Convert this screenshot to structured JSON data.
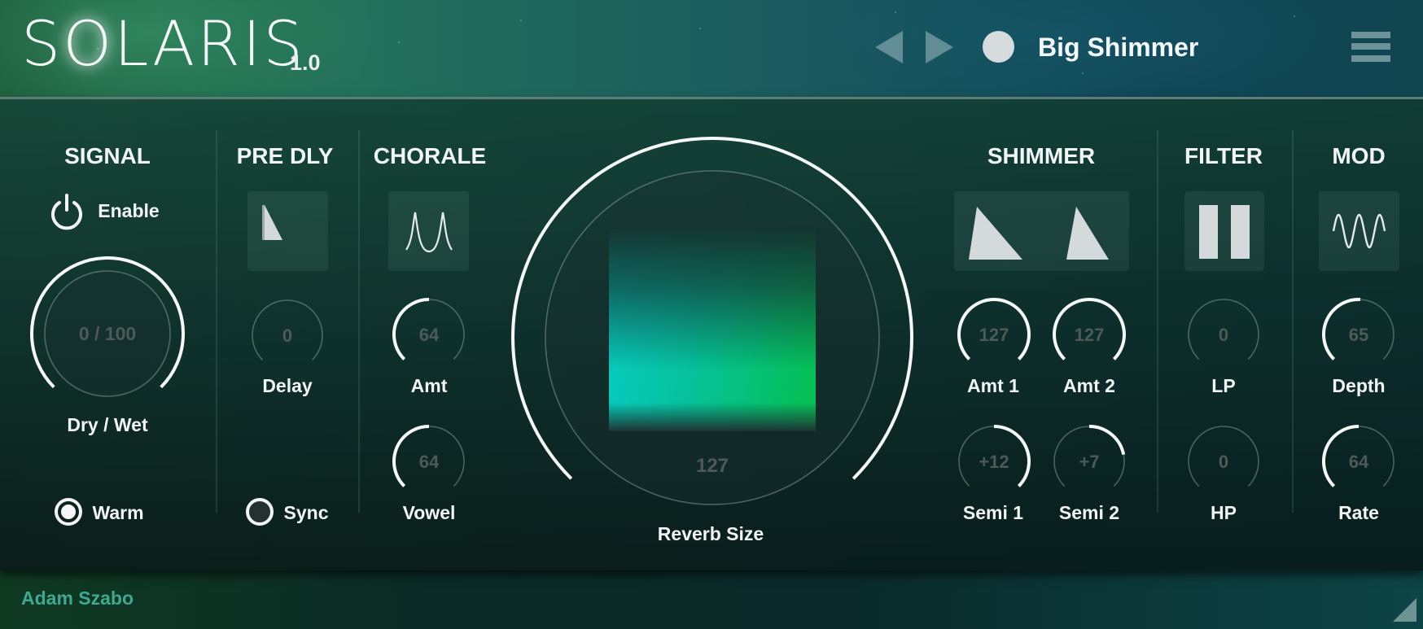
{
  "app": {
    "name_prefix": "S",
    "name_glow": "O",
    "name_suffix": "LARIS",
    "version": "1.0"
  },
  "header": {
    "prev_preset_icon": "triangle-left",
    "next_preset_icon": "triangle-right",
    "preset_indicator_icon": "circle",
    "preset_name": "Big Shimmer",
    "menu_icon": "hamburger"
  },
  "sections": {
    "signal": {
      "title": "SIGNAL",
      "enable_label": "Enable",
      "enable_icon": "power",
      "drywet": {
        "value_text": "0 / 100",
        "label": "Dry / Wet",
        "fraction": 1.0
      },
      "warm": {
        "label": "Warm",
        "checked": true
      }
    },
    "predly": {
      "title": "PRE DLY",
      "icon": "ramp-triangle",
      "delay": {
        "value_text": "0",
        "label": "Delay",
        "fraction": 0.0
      },
      "sync": {
        "label": "Sync",
        "checked": false
      }
    },
    "chorale": {
      "title": "CHORALE",
      "icon": "formant-peaks",
      "amt": {
        "value_text": "64",
        "label": "Amt",
        "fraction": 0.5
      },
      "vowel": {
        "value_text": "64",
        "label": "Vowel",
        "fraction": 0.5
      }
    },
    "reverb": {
      "value_text": "127",
      "label": "Reverb Size",
      "fraction": 1.0
    },
    "shimmer": {
      "title": "SHIMMER",
      "icon": "dual-ramp-triangles",
      "amt1": {
        "value_text": "127",
        "label": "Amt 1",
        "fraction": 1.0
      },
      "amt2": {
        "value_text": "127",
        "label": "Amt 2",
        "fraction": 1.0
      },
      "semi1": {
        "value_text": "+12",
        "label": "Semi 1",
        "bipolar_fraction": 1.0
      },
      "semi2": {
        "value_text": "+7",
        "label": "Semi 2",
        "bipolar_fraction": 0.583
      }
    },
    "filter": {
      "title": "FILTER",
      "icon": "dual-bars",
      "lp": {
        "value_text": "0",
        "label": "LP",
        "fraction": 0.0
      },
      "hp": {
        "value_text": "0",
        "label": "HP",
        "fraction": 0.0
      }
    },
    "mod": {
      "title": "MOD",
      "icon": "sine-wave",
      "depth": {
        "value_text": "65",
        "label": "Depth",
        "fraction": 0.51
      },
      "rate": {
        "value_text": "64",
        "label": "Rate",
        "fraction": 0.5
      }
    }
  },
  "footer": {
    "author": "Adam Szabo",
    "resize_icon": "resize-corner"
  }
}
